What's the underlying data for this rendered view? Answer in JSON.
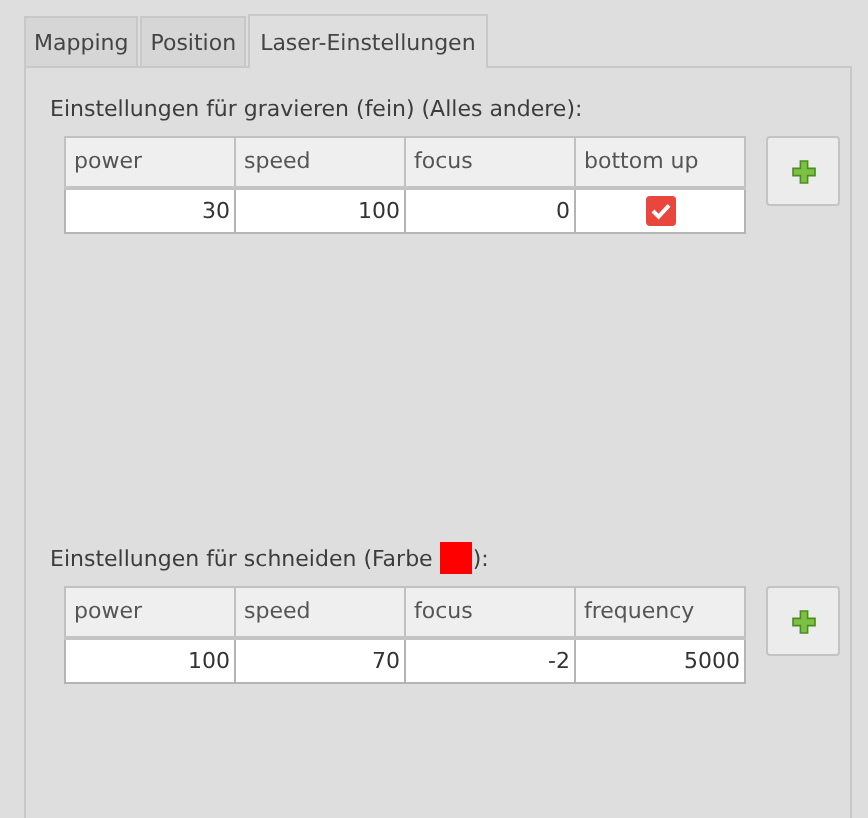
{
  "tabs": [
    {
      "label": "Mapping",
      "selected": false
    },
    {
      "label": "Position",
      "selected": false
    },
    {
      "label": "Laser-Einstellungen",
      "selected": true
    }
  ],
  "sections": [
    {
      "label_parts": [
        {
          "text": "Einstellungen für gravieren (fein) (Alles andere):"
        }
      ],
      "columns": [
        "power",
        "speed",
        "focus",
        "bottom up"
      ],
      "rows": [
        [
          {
            "kind": "text",
            "value": "30"
          },
          {
            "kind": "text",
            "value": "100"
          },
          {
            "kind": "text",
            "value": "0"
          },
          {
            "kind": "checkbox",
            "checked": true
          }
        ]
      ]
    },
    {
      "label_parts": [
        {
          "text": "Einstellungen für schneiden (Farbe"
        },
        {
          "color": "#ff0000"
        },
        {
          "text": "):"
        }
      ],
      "columns": [
        "power",
        "speed",
        "focus",
        "frequency"
      ],
      "rows": [
        [
          {
            "kind": "text",
            "value": "100"
          },
          {
            "kind": "text",
            "value": "70"
          },
          {
            "kind": "text",
            "value": "-2"
          },
          {
            "kind": "text",
            "value": "5000"
          }
        ]
      ]
    }
  ]
}
